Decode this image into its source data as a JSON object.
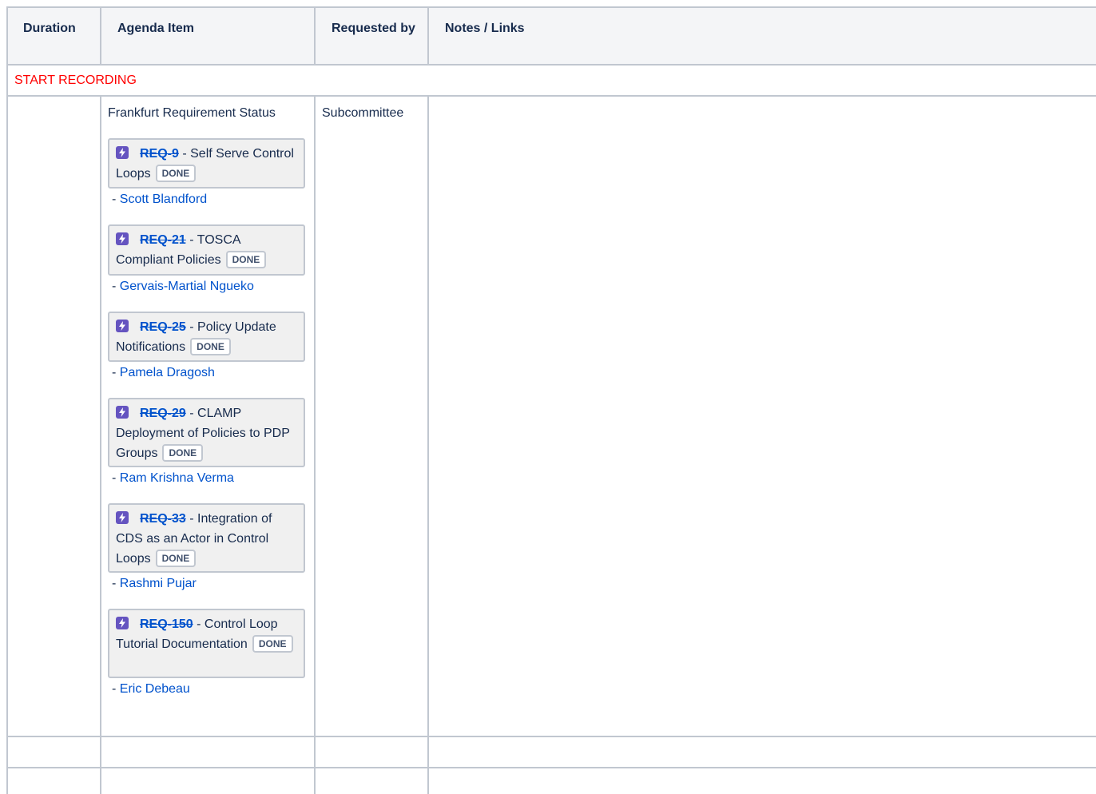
{
  "table": {
    "headers": [
      "Duration",
      "Agenda Item",
      "Requested by",
      "Notes / Links"
    ],
    "start_recording": "START RECORDING",
    "row": {
      "agenda_title": "Frankfurt Requirement Status",
      "requested_by": "Subcommittee",
      "items": [
        {
          "key": "REQ-9",
          "title": "Self Serve Control Loops",
          "status": "DONE",
          "owner_prefix": "- ",
          "owner": "Scott Blandford"
        },
        {
          "key": "REQ-21",
          "title": "TOSCA Compliant Policies",
          "status": "DONE",
          "owner_prefix": "- ",
          "owner": "Gervais-Martial Ngueko"
        },
        {
          "key": "REQ-25",
          "title": "Policy Update Notifications",
          "status": "DONE",
          "owner_prefix": "- ",
          "owner": "Pamela Dragosh"
        },
        {
          "key": "REQ-29",
          "title": "CLAMP Deployment of Policies to PDP Groups",
          "status": "DONE",
          "owner_prefix": "- ",
          "owner": "Ram Krishna Verma"
        },
        {
          "key": "REQ-33",
          "title": "Integration of CDS as an Actor in Control Loops",
          "status": "DONE",
          "owner_prefix": "- ",
          "owner": "Rashmi Pujar"
        },
        {
          "key": "REQ-150",
          "title": "Control Loop Tutorial Documentation",
          "status": "DONE",
          "owner_prefix": "- ",
          "owner": "Eric Debeau"
        }
      ]
    }
  },
  "colors": {
    "link": "#0052cc",
    "start_recording": "#ff0000",
    "jira_icon": "#6554c0",
    "border": "#c1c7d0",
    "header_bg": "#f4f5f7"
  }
}
